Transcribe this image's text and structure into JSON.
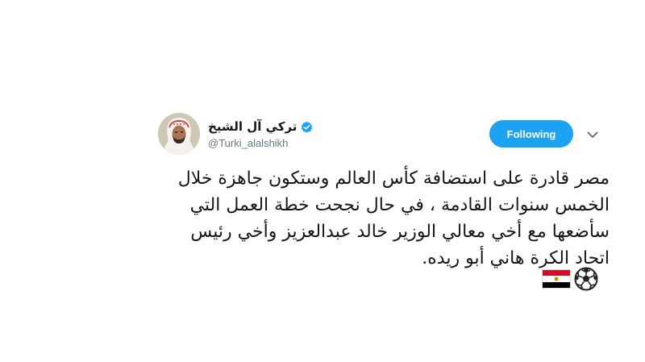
{
  "tweet": {
    "author": {
      "display_name": "تركي آل الشيخ",
      "handle": "@Turki_alalshikh",
      "verified": true,
      "avatar_icon": "user-avatar"
    },
    "follow_button": {
      "label": "Following",
      "color": "#1da1f2"
    },
    "menu_icon": "chevron-down-icon",
    "text_lines": [
      "مصر قادرة على استضافة كأس العالم وستكون جاهزة خلال",
      "الخمس سنوات القادمة ، في حال نجحت خطة العمل التي",
      "سأضعها مع أخي معالي الوزير خالد عبدالعزيز وأخي رئيس",
      "اتحاد الكرة هاني أبو ريده."
    ],
    "emojis": [
      "soccer-ball-icon",
      "egypt-flag-icon"
    ]
  }
}
